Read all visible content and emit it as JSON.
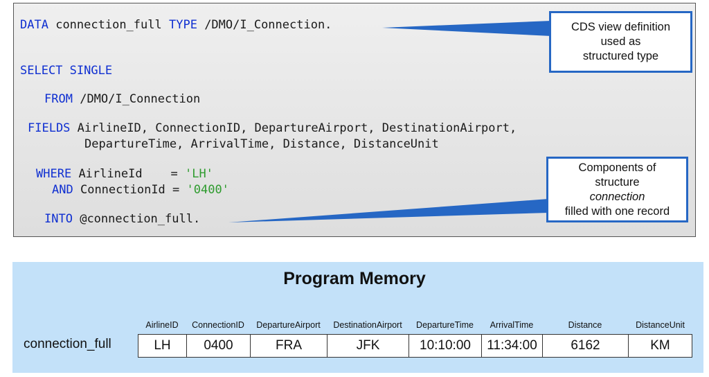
{
  "code": {
    "line1": {
      "kw_data": "DATA",
      "var": "connection_full",
      "kw_type": "TYPE",
      "type_name": "/DMO/I_Connection."
    },
    "line2": {
      "kw": "SELECT SINGLE"
    },
    "line3": {
      "kw": "FROM",
      "text": "/DMO/I_Connection"
    },
    "line4": {
      "kw": "FIELDS",
      "text": "AirlineID, ConnectionID, DepartureAirport, DestinationAirport,"
    },
    "line5": {
      "text": "DepartureTime, ArrivalTime, Distance, DistanceUnit"
    },
    "line6": {
      "kw": "WHERE",
      "text": "AirlineId    = ",
      "str": "'LH'"
    },
    "line7": {
      "kw": "AND",
      "text": "ConnectionId = ",
      "str": "'0400'"
    },
    "line8": {
      "kw": "INTO",
      "text": "@connection_full."
    }
  },
  "callouts": {
    "top": [
      "CDS view definition",
      "used as",
      "structured type"
    ],
    "bottom_line1": "Components of",
    "bottom_line2_prefix": "structure ",
    "bottom_line2_italic": "connection",
    "bottom_line3": "filled with one record"
  },
  "memory": {
    "title": "Program Memory",
    "variable": "connection_full",
    "columns": [
      "AirlineID",
      "ConnectionID",
      "DepartureAirport",
      "DestinationAirport",
      "DepartureTime",
      "ArrivalTime",
      "Distance",
      "DistanceUnit"
    ],
    "values": [
      "LH",
      "0400",
      "FRA",
      "JFK",
      "10:10:00",
      "11:34:00",
      "6162",
      "KM"
    ]
  },
  "colors": {
    "keyword": "#0f2fd1",
    "string": "#2e9b2e",
    "callout_border": "#2667c4",
    "memory_background": "#c3e1f9"
  }
}
